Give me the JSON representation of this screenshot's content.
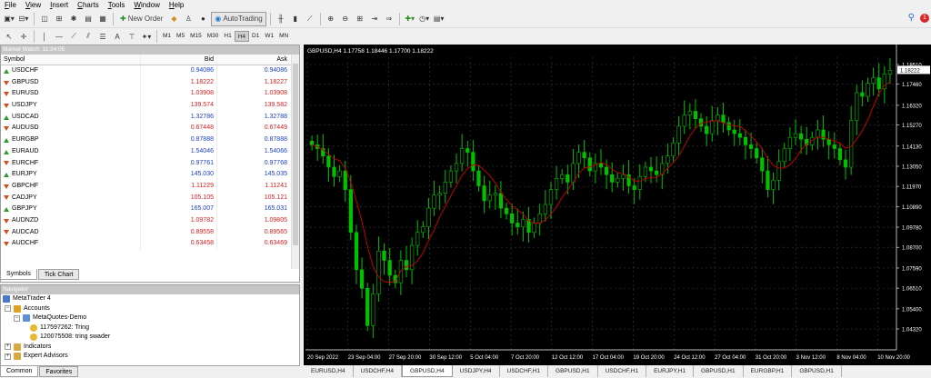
{
  "menu": [
    "File",
    "View",
    "Insert",
    "Charts",
    "Tools",
    "Window",
    "Help"
  ],
  "toolbar": {
    "new_order_label": "New Order",
    "autotrading_label": "AutoTrading"
  },
  "timeframes": [
    "M1",
    "M5",
    "M15",
    "M30",
    "H1",
    "H4",
    "D1",
    "W1",
    "MN"
  ],
  "active_timeframe": "H4",
  "market_watch": {
    "title": "Market Watch: 11:34:05",
    "columns": {
      "symbol": "Symbol",
      "bid": "Bid",
      "ask": "Ask"
    },
    "rows": [
      {
        "symbol": "USDCHF",
        "bid": "0.94086",
        "ask": "0.94086",
        "dir": "up",
        "color": "blue"
      },
      {
        "symbol": "GBPUSD",
        "bid": "1.18222",
        "ask": "1.18227",
        "dir": "dn",
        "color": "red"
      },
      {
        "symbol": "EURUSD",
        "bid": "1.03908",
        "ask": "1.03908",
        "dir": "dn",
        "color": "red"
      },
      {
        "symbol": "USDJPY",
        "bid": "139.574",
        "ask": "139.582",
        "dir": "dn",
        "color": "red"
      },
      {
        "symbol": "USDCAD",
        "bid": "1.32786",
        "ask": "1.32788",
        "dir": "up",
        "color": "blue"
      },
      {
        "symbol": "AUDUSD",
        "bid": "0.67448",
        "ask": "0.67449",
        "dir": "dn",
        "color": "red"
      },
      {
        "symbol": "EURGBP",
        "bid": "0.87888",
        "ask": "0.87888",
        "dir": "up",
        "color": "blue"
      },
      {
        "symbol": "EURAUD",
        "bid": "1.54046",
        "ask": "1.54066",
        "dir": "up",
        "color": "blue"
      },
      {
        "symbol": "EURCHF",
        "bid": "0.97761",
        "ask": "0.97768",
        "dir": "dn",
        "color": "blue"
      },
      {
        "symbol": "EURJPY",
        "bid": "145.030",
        "ask": "145.035",
        "dir": "up",
        "color": "blue"
      },
      {
        "symbol": "GBPCHF",
        "bid": "1.11229",
        "ask": "1.11241",
        "dir": "dn",
        "color": "red"
      },
      {
        "symbol": "CADJPY",
        "bid": "105.105",
        "ask": "105.121",
        "dir": "dn",
        "color": "red"
      },
      {
        "symbol": "GBPJPY",
        "bid": "165.007",
        "ask": "165.031",
        "dir": "up",
        "color": "blue"
      },
      {
        "symbol": "AUDNZD",
        "bid": "1.09782",
        "ask": "1.09805",
        "dir": "dn",
        "color": "red"
      },
      {
        "symbol": "AUDCAD",
        "bid": "0.89558",
        "ask": "0.89565",
        "dir": "dn",
        "color": "red"
      },
      {
        "symbol": "AUDCHF",
        "bid": "0.63458",
        "ask": "0.63469",
        "dir": "dn",
        "color": "red"
      }
    ],
    "tabs": [
      "Symbols",
      "Tick Chart"
    ],
    "active_tab": "Symbols"
  },
  "navigator": {
    "title": "Navigator",
    "root": "MetaTrader 4",
    "accounts_label": "Accounts",
    "server": "MetaQuotes-Demo",
    "accounts": [
      "117597262: Tring",
      "120075508: tring swader"
    ],
    "indicators_label": "Indicators",
    "experts_label": "Expert Advisors",
    "tabs": [
      "Common",
      "Favorites"
    ],
    "active_tab": "Common"
  },
  "chart": {
    "header": "GBPUSD,H4  1.17758 1.18446 1.17700 1.18222",
    "current_price": "1.18222",
    "colors": {
      "background": "#000000",
      "bull": "#00c000",
      "ma": "#c00000",
      "grid": "#3a3a3a",
      "axis_text": "#ffffff"
    }
  },
  "chart_data": {
    "type": "candlestick",
    "title": "GBPUSD,H4",
    "ylim": [
      1.032,
      1.189
    ],
    "y_ticks": [
      "1.18510",
      "1.17460",
      "1.16320",
      "1.15270",
      "1.14130",
      "1.13050",
      "1.11970",
      "1.10890",
      "1.09780",
      "1.08700",
      "1.07590",
      "1.06510",
      "1.05400",
      "1.04320"
    ],
    "x_ticks": [
      "20 Sep 2022",
      "23 Sep 04:00",
      "27 Sep 20:00",
      "30 Sep 12:00",
      "5 Oct 04:00",
      "7 Oct 20:00",
      "12 Oct 12:00",
      "17 Oct 04:00",
      "19 Oct 20:00",
      "24 Oct 12:00",
      "27 Oct 04:00",
      "31 Oct 20:00",
      "3 Nov 12:00",
      "8 Nov 04:00",
      "10 Nov 20:00"
    ],
    "close": [
      1.142,
      1.14,
      1.136,
      1.13,
      1.125,
      1.128,
      1.118,
      1.095,
      1.075,
      1.065,
      1.045,
      1.062,
      1.085,
      1.08,
      1.072,
      1.068,
      1.08,
      1.075,
      1.088,
      1.095,
      1.098,
      1.108,
      1.115,
      1.116,
      1.122,
      1.128,
      1.132,
      1.14,
      1.138,
      1.128,
      1.12,
      1.112,
      1.115,
      1.116,
      1.108,
      1.105,
      1.1,
      1.098,
      1.102,
      1.095,
      1.1,
      1.105,
      1.11,
      1.118,
      1.124,
      1.126,
      1.122,
      1.132,
      1.138,
      1.135,
      1.128,
      1.132,
      1.13,
      1.126,
      1.122,
      1.124,
      1.126,
      1.12,
      1.118,
      1.125,
      1.13,
      1.128,
      1.126,
      1.132,
      1.136,
      1.143,
      1.152,
      1.158,
      1.16,
      1.156,
      1.152,
      1.148,
      1.155,
      1.158,
      1.154,
      1.15,
      1.148,
      1.146,
      1.142,
      1.14,
      1.135,
      1.128,
      1.118,
      1.123,
      1.133,
      1.14,
      1.146,
      1.148,
      1.145,
      1.142,
      1.146,
      1.15,
      1.145,
      1.142,
      1.14,
      1.134,
      1.13,
      1.155,
      1.17,
      1.168,
      1.175,
      1.178,
      1.172,
      1.18,
      1.182
    ]
  }
}
